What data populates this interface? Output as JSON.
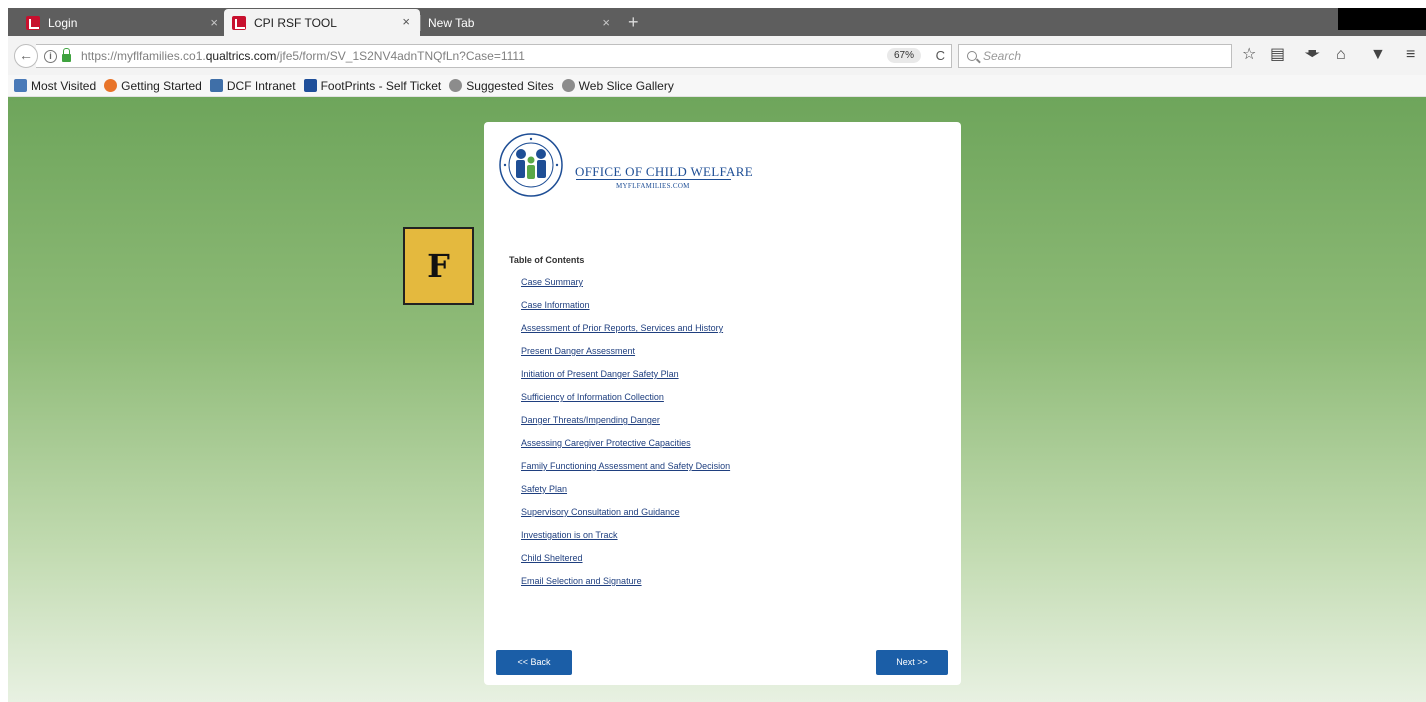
{
  "browser": {
    "tabs": [
      {
        "label": "Login",
        "active": false
      },
      {
        "label": "CPI RSF TOOL",
        "active": true
      },
      {
        "label": "New Tab",
        "active": false
      }
    ],
    "close_glyph": "×",
    "newtab_glyph": "+",
    "url": {
      "prefix": "https://myflfamilies.co1.",
      "domain": "qualtrics.com",
      "suffix": "/jfe5/form/SV_1S2NV4adnTNQfLn?Case=1111"
    },
    "zoom": "67%",
    "search_placeholder": "Search",
    "bookmarks": [
      {
        "label": "Most Visited",
        "color": "#4a7ab8"
      },
      {
        "label": "Getting Started",
        "color": "#e8742a"
      },
      {
        "label": "DCF Intranet",
        "color": "#3f6fa8"
      },
      {
        "label": "FootPrints - Self Ticket",
        "color": "#1f4f9a"
      },
      {
        "label": "Suggested Sites",
        "color": "#8c8c8c"
      },
      {
        "label": "Web Slice Gallery",
        "color": "#8c8c8c"
      }
    ]
  },
  "page": {
    "logo": {
      "title": "OFFICE OF CHILD WELFARE",
      "subtitle": "MYFLFAMILIES.COM",
      "brand_color": "#1e4e95"
    },
    "toc_heading": "Table of Contents",
    "toc_items": [
      "Case Summary",
      "Case Information",
      "Assessment of Prior Reports, Services and History",
      "Present Danger Assessment",
      "Initiation of Present Danger Safety Plan",
      "Sufficiency of Information Collection",
      "Danger Threats/Impending Danger",
      "Assessing Caregiver Protective Capacities",
      "Family Functioning Assessment and Safety Decision",
      "Safety Plan",
      "Supervisory Consultation and Guidance",
      "Investigation is on Track",
      "Child Sheltered",
      "Email Selection and Signature"
    ],
    "back_label": "<< Back",
    "next_label": "Next >>",
    "marker_letter": "F",
    "marker_color": "#e4b93e",
    "button_color": "#1b5ea7"
  }
}
